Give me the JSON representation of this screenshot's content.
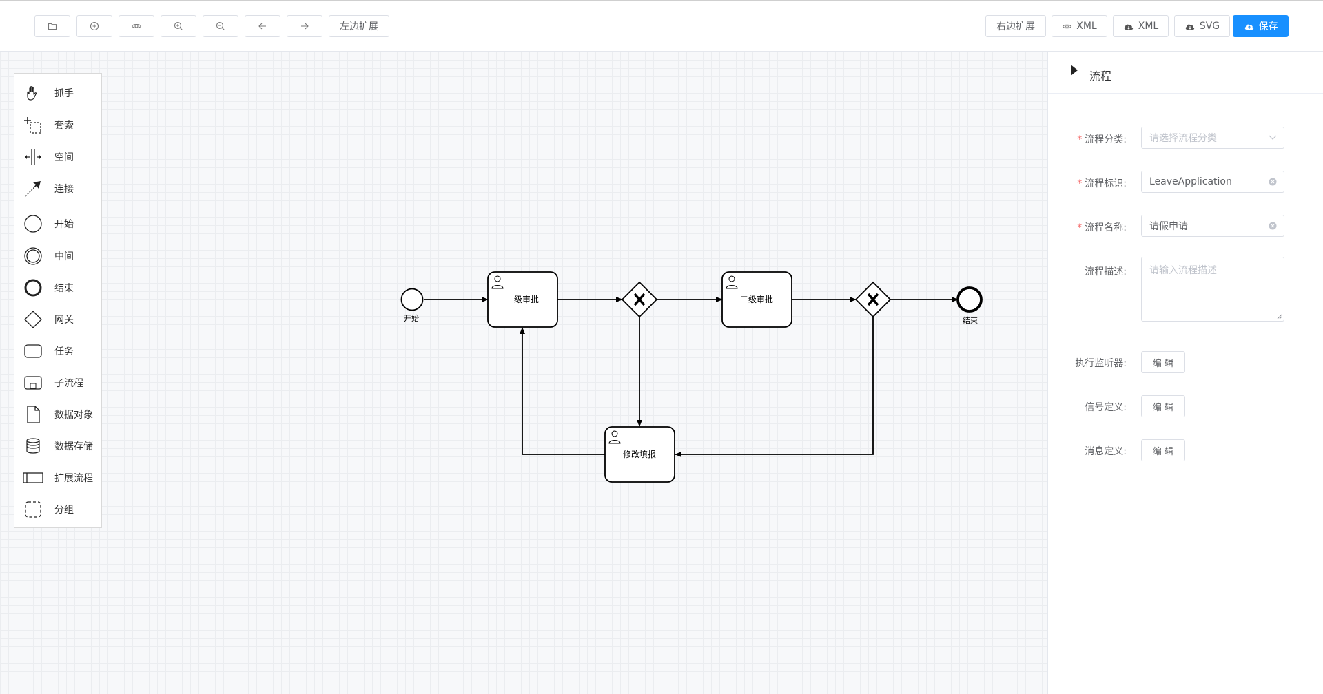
{
  "toolbar": {
    "left_buttons": [
      {
        "name": "open-file-button",
        "icon": "folder-icon"
      },
      {
        "name": "add-button",
        "icon": "plus-circle-icon"
      },
      {
        "name": "preview-button",
        "icon": "eye-icon"
      },
      {
        "name": "zoom-in-button",
        "icon": "zoom-in-icon"
      },
      {
        "name": "zoom-out-button",
        "icon": "zoom-out-icon"
      },
      {
        "name": "undo-button",
        "icon": "arrow-left-icon"
      },
      {
        "name": "redo-button",
        "icon": "arrow-right-icon"
      }
    ],
    "left_expand_label": "左边扩展",
    "right_expand_label": "右边扩展",
    "view_xml_label": "XML",
    "download_xml_label": "XML",
    "download_svg_label": "SVG",
    "save_label": "保存",
    "accent_color": "#1890ff"
  },
  "palette": {
    "items": [
      {
        "label": "抓手",
        "icon": "hand-tool-icon"
      },
      {
        "label": "套索",
        "icon": "lasso-tool-icon"
      },
      {
        "label": "空间",
        "icon": "space-tool-icon"
      },
      {
        "label": "连接",
        "icon": "connect-tool-icon"
      },
      {
        "label": "开始",
        "icon": "start-event-icon"
      },
      {
        "label": "中间",
        "icon": "intermediate-event-icon"
      },
      {
        "label": "结束",
        "icon": "end-event-icon"
      },
      {
        "label": "网关",
        "icon": "gateway-icon"
      },
      {
        "label": "任务",
        "icon": "task-icon"
      },
      {
        "label": "子流程",
        "icon": "subprocess-icon"
      },
      {
        "label": "数据对象",
        "icon": "data-object-icon"
      },
      {
        "label": "数据存储",
        "icon": "data-store-icon"
      },
      {
        "label": "扩展流程",
        "icon": "pool-icon"
      },
      {
        "label": "分组",
        "icon": "group-icon"
      }
    ]
  },
  "diagram": {
    "start_label": "开始",
    "end_label": "结束",
    "task1_label": "一级审批",
    "task2_label": "二级审批",
    "task3_label": "修改填报"
  },
  "panel": {
    "title": "流程",
    "fields": {
      "category_label": "流程分类:",
      "category_placeholder": "请选择流程分类",
      "key_label": "流程标识:",
      "key_value": "LeaveApplication",
      "name_label": "流程名称:",
      "name_value": "请假申请",
      "desc_label": "流程描述:",
      "desc_placeholder": "请输入流程描述",
      "listener_label": "执行监听器:",
      "signal_label": "信号定义:",
      "message_label": "消息定义:",
      "edit_label": "编 辑"
    }
  }
}
